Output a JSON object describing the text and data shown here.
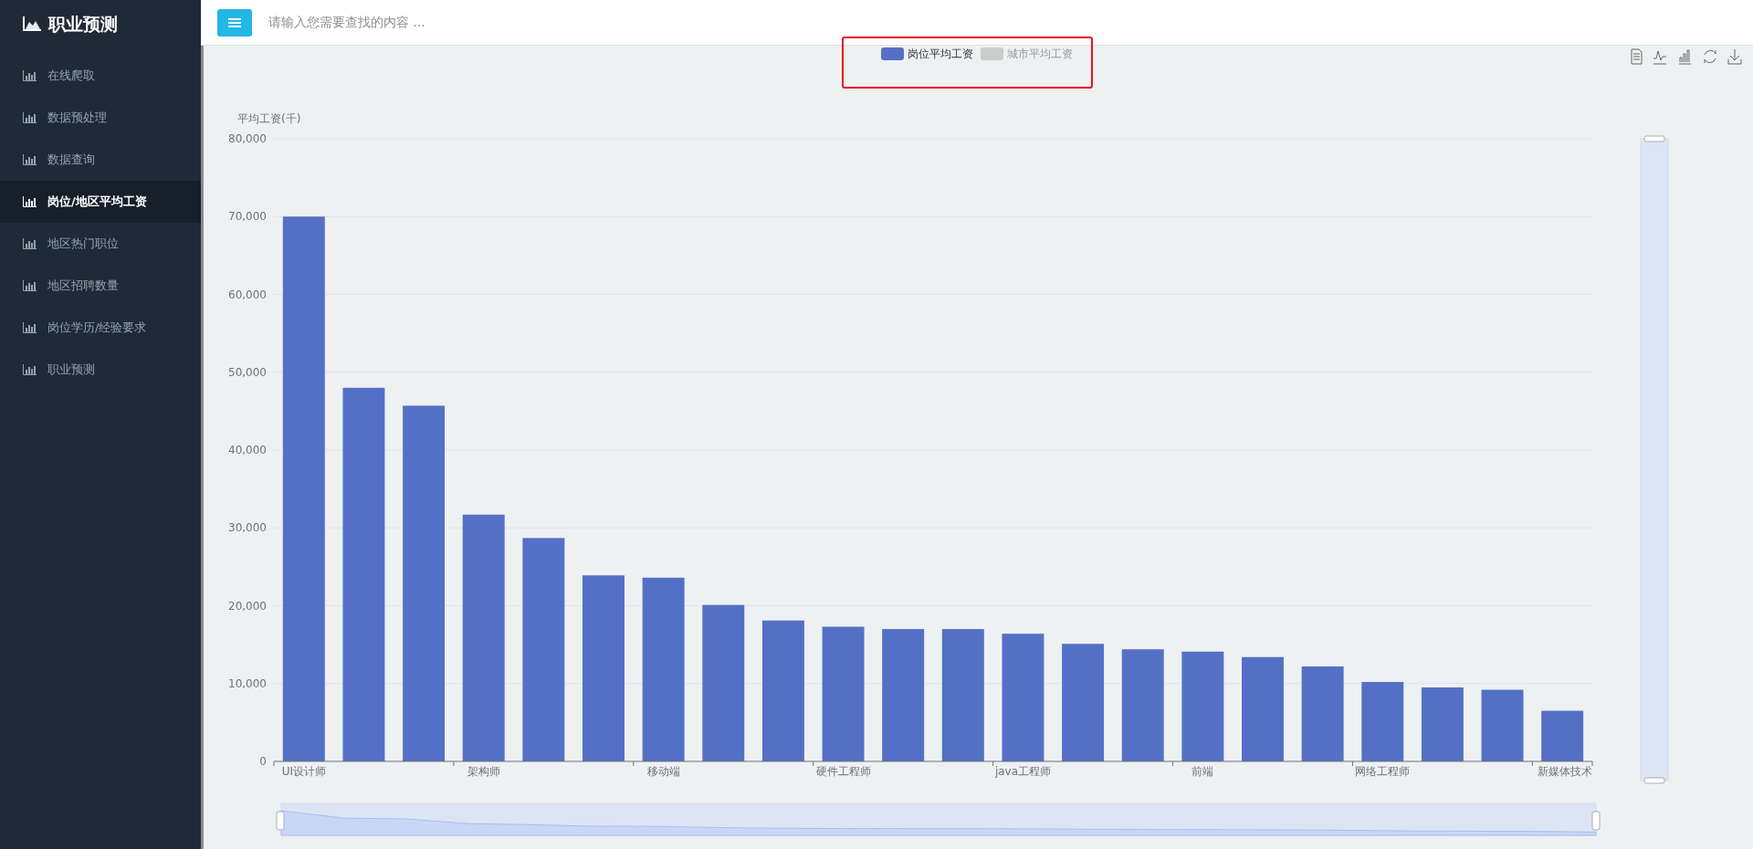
{
  "sidebar": {
    "title": "职业预测",
    "items": [
      {
        "label": "在线爬取",
        "selected": false
      },
      {
        "label": "数据预处理",
        "selected": false
      },
      {
        "label": "数据查询",
        "selected": false
      },
      {
        "label": "岗位/地区平均工资",
        "selected": true
      },
      {
        "label": "地区热门职位",
        "selected": false
      },
      {
        "label": "地区招聘数量",
        "selected": false
      },
      {
        "label": "岗位学历/经验要求",
        "selected": false
      },
      {
        "label": "职业预测",
        "selected": false
      }
    ]
  },
  "search": {
    "placeholder": "请输入您需要查找的内容 ..."
  },
  "legend": [
    {
      "label": "岗位平均工资",
      "selected": true,
      "color": "#5470c6"
    },
    {
      "label": "城市平均工资",
      "selected": false
    }
  ],
  "chart_data": {
    "type": "bar",
    "ylabel": "平均工资(千)",
    "categories": [
      "UI设计师",
      null,
      null,
      "架构师",
      null,
      null,
      "移动端",
      null,
      null,
      "硬件工程师",
      null,
      null,
      "java工程师",
      null,
      null,
      "前端",
      null,
      null,
      "网络工程师",
      null,
      null,
      "新媒体技术"
    ],
    "values": [
      70000,
      48000,
      45700,
      31700,
      28700,
      23900,
      23600,
      20100,
      18100,
      17300,
      17000,
      17000,
      16400,
      15100,
      14400,
      14100,
      13400,
      12200,
      10200,
      9500,
      9200,
      6500
    ],
    "ylim": [
      0,
      80000
    ],
    "grid": true,
    "yticks": [
      {
        "value": 0,
        "label": "0"
      },
      {
        "value": 10000,
        "label": "10,000"
      },
      {
        "value": 20000,
        "label": "20,000"
      },
      {
        "value": 30000,
        "label": "30,000"
      },
      {
        "value": 40000,
        "label": "40,000"
      },
      {
        "value": 50000,
        "label": "50,000"
      },
      {
        "value": 60000,
        "label": "60,000"
      },
      {
        "value": 70000,
        "label": "70,000"
      },
      {
        "value": 80000,
        "label": "80,000"
      }
    ]
  }
}
